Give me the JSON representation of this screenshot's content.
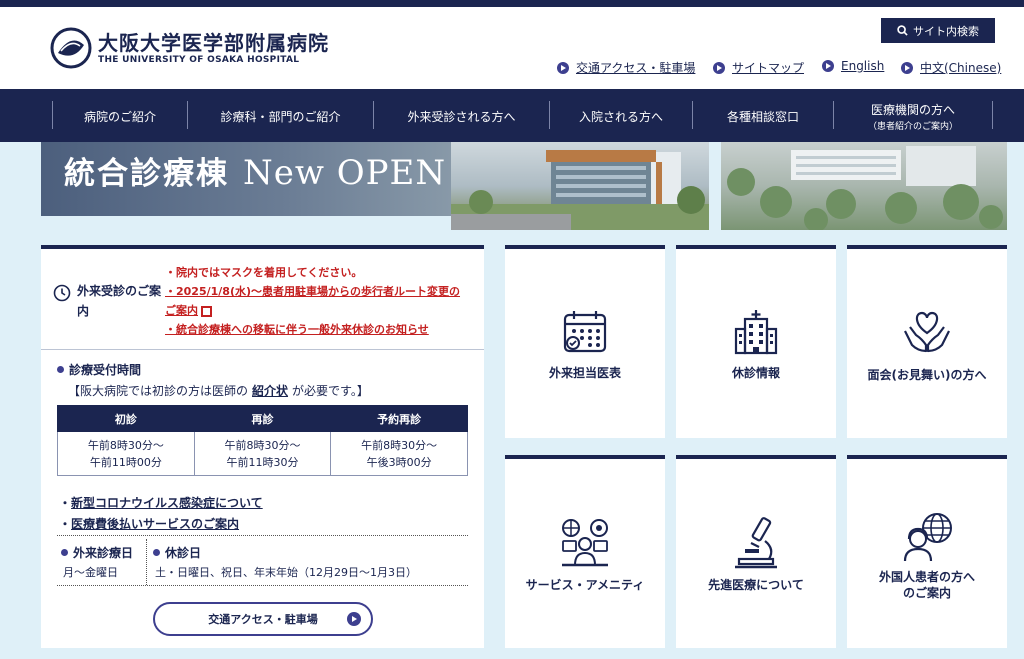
{
  "header": {
    "logo_jp": "大阪大学医学部附属病院",
    "logo_en": "THE UNIVERSITY OF OSAKA HOSPITAL",
    "site_search": "サイト内検索",
    "util_links": [
      "交通アクセス・駐車場",
      "サイトマップ",
      "English",
      "中文(Chinese)"
    ]
  },
  "nav": {
    "items": [
      {
        "label": "病院のご紹介",
        "sub": ""
      },
      {
        "label": "診療科・部門のご紹介",
        "sub": ""
      },
      {
        "label": "外来受診される方へ",
        "sub": ""
      },
      {
        "label": "入院される方へ",
        "sub": ""
      },
      {
        "label": "各種相談窓口",
        "sub": ""
      },
      {
        "label": "医療機関の方へ",
        "sub": "（患者紹介のご案内）"
      }
    ]
  },
  "banner": {
    "title_jp": "統合診療棟",
    "title_en": "New OPEN"
  },
  "notice": {
    "heading": "外来受診のご案内",
    "items": [
      "・院内ではマスクを着用してください。",
      "・2025/1/8(水)〜患者用駐車場からの歩行者ルート変更のご案内",
      "・統合診療棟への移転に伴う一般外来休診のお知らせ"
    ]
  },
  "hours": {
    "title": "診療受付時間",
    "note_pre": "【阪大病院では初診の方は医師の",
    "note_link": "紹介状",
    "note_post": "が必要です。】",
    "columns": [
      "初診",
      "再診",
      "予約再診"
    ],
    "rows": [
      [
        "午前8時30分〜",
        "午前8時30分〜",
        "午前8時30分〜"
      ],
      [
        "午前11時00分",
        "午前11時30分",
        "午後3時00分"
      ]
    ]
  },
  "links": [
    "新型コロナウイルス感染症について",
    "医療費後払いサービスのご案内"
  ],
  "schedule": {
    "days_label": "外来診療日",
    "days_value": "月〜金曜日",
    "holiday_label": "休診日",
    "holiday_value": "土・日曜日、祝日、年末年始（12月29日〜1月3日）"
  },
  "access_button": "交通アクセス・駐車場",
  "tiles": [
    {
      "label": "外来担当医表",
      "icon": "calendar-icon"
    },
    {
      "label": "休診情報",
      "icon": "hospital-building-icon"
    },
    {
      "label": "面会(お見舞い)の方へ",
      "icon": "heart-hands-icon"
    },
    {
      "label": "サービス・アメニティ",
      "icon": "services-icon"
    },
    {
      "label": "先進医療について",
      "icon": "microscope-icon"
    },
    {
      "label": "外国人患者の方へ",
      "label2": "のご案内",
      "icon": "globe-person-icon"
    }
  ],
  "colors": {
    "navy": "#1b2550",
    "accent": "#3d3f8f",
    "alert": "#c42020",
    "bg": "#dff0f8"
  }
}
